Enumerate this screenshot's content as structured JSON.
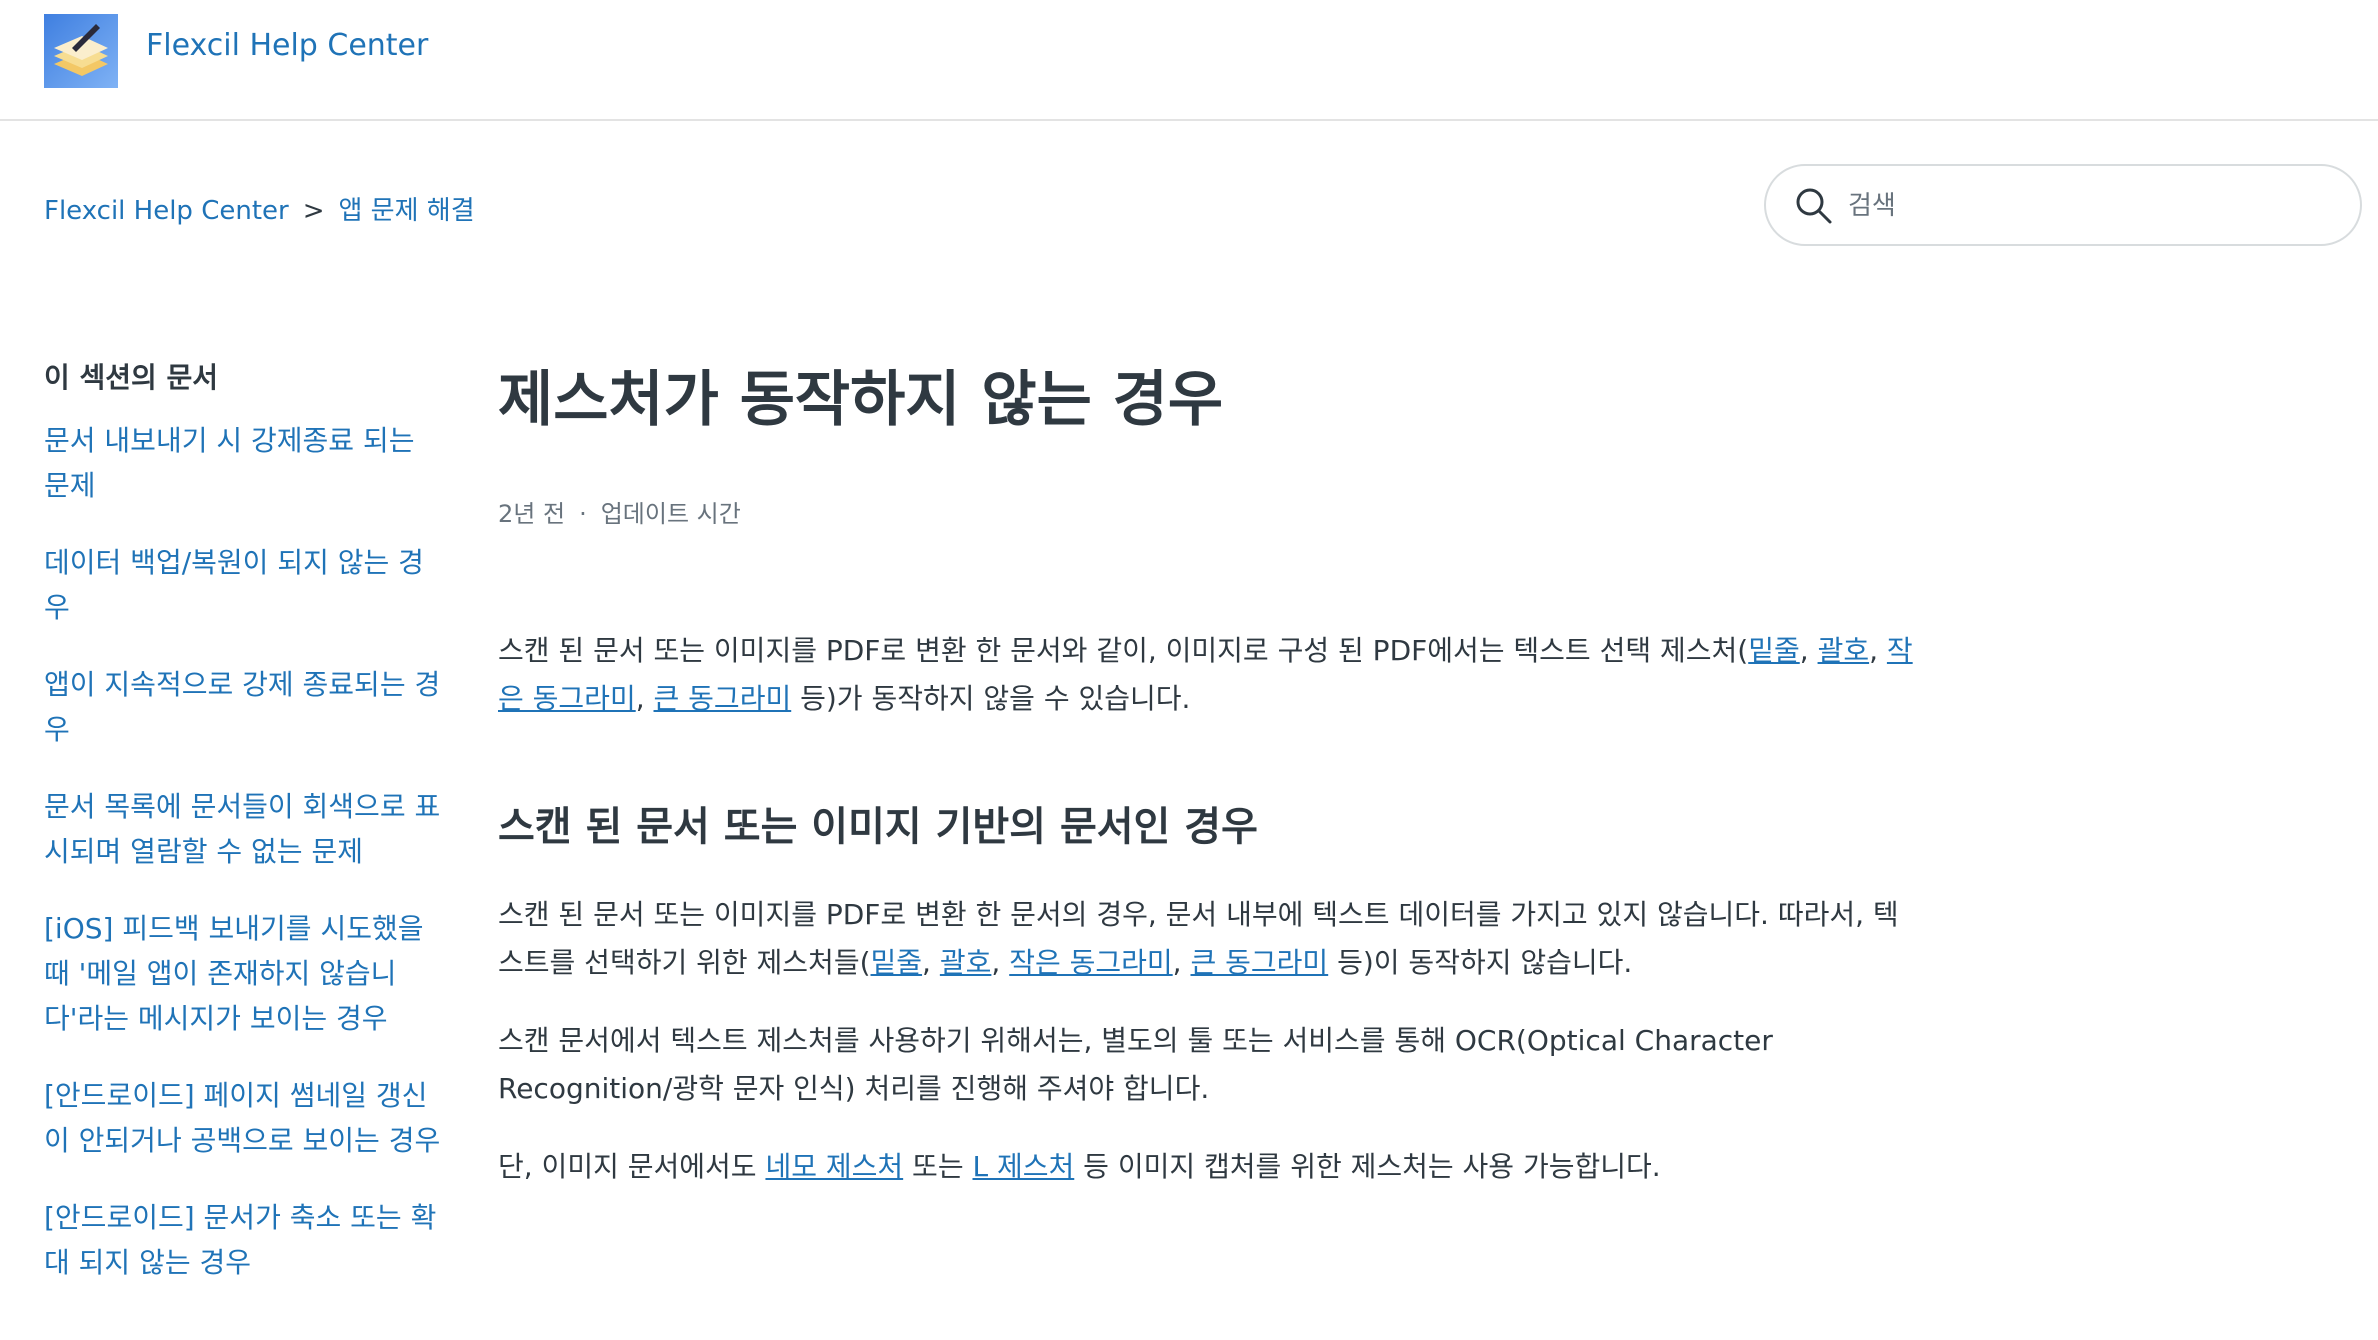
{
  "header": {
    "brand": "Flexcil Help Center"
  },
  "breadcrumb": {
    "home": "Flexcil Help Center",
    "separator": ">",
    "section": "앱 문제 해결"
  },
  "search": {
    "placeholder": "검색"
  },
  "sidebar": {
    "heading": "이 섹션의 문서",
    "items": [
      "문서 내보내기 시 강제종료 되는 문제",
      "데이터 백업/복원이 되지 않는 경우",
      "앱이 지속적으로 강제 종료되는 경우",
      "문서 목록에 문서들이 회색으로 표시되며 열람할 수 없는 문제",
      "[iOS] 피드백 보내기를 시도했을 때 '메일 앱이 존재하지 않습니다'라는 메시지가 보이는 경우",
      "[안드로이드] 페이지 썸네일 갱신이 안되거나 공백으로 보이는 경우",
      "[안드로이드] 문서가 축소 또는 확대 되지 않는 경우"
    ]
  },
  "article": {
    "title": "제스처가 동작하지 않는 경우",
    "meta_time": "2년 전",
    "meta_dot": "·",
    "meta_label": "업데이트 시간",
    "intro": {
      "text1": "스캔 된 문서 또는 이미지를 PDF로 변환 한 문서와 같이, 이미지로 구성 된 PDF에서는 텍스트 선택 제스처(",
      "link1": "밑줄",
      "link2": "괄호",
      "link3": "작은 동그라미",
      "link4": "큰 동그라미",
      "text2": " 등)가 동작하지 않을 수 있습니다."
    },
    "section_heading": "스캔 된 문서 또는 이미지 기반의 문서인 경우",
    "p1": {
      "text1": "스캔 된 문서 또는 이미지를 PDF로 변환 한 문서의 경우, 문서 내부에 텍스트 데이터를 가지고 있지 않습니다. 따라서, 텍스트를 선택하기 위한 제스처들(",
      "link1": "밑줄",
      "link2": "괄호",
      "link3": "작은 동그라미",
      "link4": "큰 동그라미",
      "text2": " 등)이 동작하지 않습니다."
    },
    "p2": "스캔 문서에서 텍스트 제스처를 사용하기 위해서는, 별도의 툴 또는 서비스를 통해 OCR(Optical Character Recognition/광학 문자 인식) 처리를 진행해 주셔야 합니다.",
    "p3": {
      "text1": "단, 이미지 문서에서도 ",
      "link1": "네모 제스처",
      "text2": " 또는 ",
      "link2": "L 제스처",
      "text3": " 등 이미지 캡처를 위한 제스처는 사용 가능합니다."
    }
  }
}
